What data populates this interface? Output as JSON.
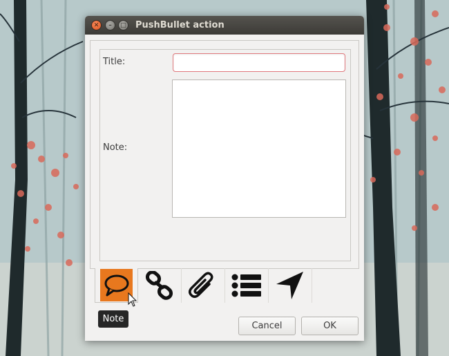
{
  "window": {
    "title": "PushBullet action",
    "close_icon": "window-close-icon",
    "minimize_icon": "window-minimize-icon",
    "maximize_icon": "window-maximize-icon"
  },
  "form": {
    "title_label": "Title:",
    "title_value": "",
    "note_label": "Note:",
    "note_value": ""
  },
  "tabs": [
    {
      "name": "note",
      "icon": "speech-bubble-icon",
      "active": true
    },
    {
      "name": "link",
      "icon": "link-icon",
      "active": false
    },
    {
      "name": "file",
      "icon": "paperclip-icon",
      "active": false
    },
    {
      "name": "list",
      "icon": "list-icon",
      "active": false
    },
    {
      "name": "address",
      "icon": "location-arrow-icon",
      "active": false
    }
  ],
  "tooltip": "Note",
  "buttons": {
    "cancel": "Cancel",
    "ok": "OK"
  },
  "colors": {
    "accent": "#e8781e",
    "title_focus_border": "#e0787c",
    "titlebar": "#3c3b37"
  }
}
